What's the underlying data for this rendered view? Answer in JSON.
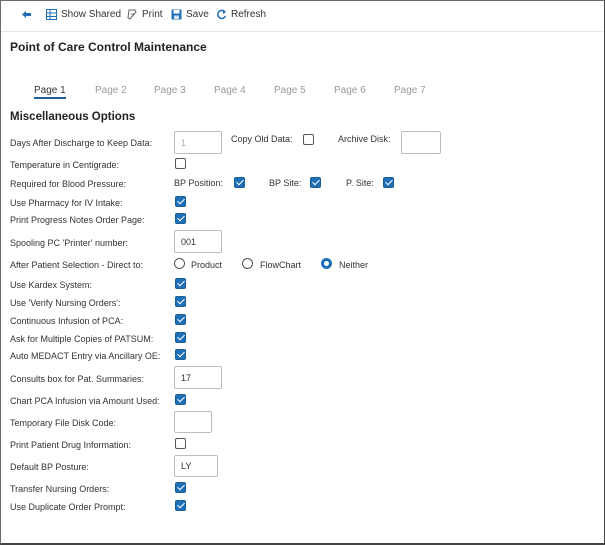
{
  "toolbar": {
    "show_shared": "Show Shared",
    "print": "Print",
    "save": "Save",
    "refresh": "Refresh"
  },
  "title": "Point of Care Control Maintenance",
  "tabs": [
    "Page 1",
    "Page 2",
    "Page 3",
    "Page 4",
    "Page 5",
    "Page 6",
    "Page 7"
  ],
  "active_tab": "Page 1",
  "section": "Miscellaneous Options",
  "fields": {
    "days_after_discharge": {
      "label": "Days After Discharge to Keep Data:",
      "value": "1"
    },
    "copy_old_data": {
      "label": "Copy Old Data:",
      "checked": false
    },
    "archive_disk": {
      "label": "Archive Disk:",
      "value": ""
    },
    "temperature": {
      "label": "Temperature in Centigrade:",
      "checked": false
    },
    "required_bp": {
      "label": "Required for Blood Pressure:"
    },
    "bp_position": {
      "label": "BP Position:",
      "checked": true
    },
    "bp_site": {
      "label": "BP Site:",
      "checked": true
    },
    "p_site": {
      "label": "P. Site:",
      "checked": true
    },
    "use_pharmacy": {
      "label": "Use Pharmacy for IV Intake:",
      "checked": true
    },
    "print_progress": {
      "label": "Print Progress Notes Order Page:",
      "checked": true
    },
    "spooling_pc": {
      "label": "Spooling PC 'Printer' number:",
      "value": "001"
    },
    "after_patient": {
      "label": "After Patient Selection - Direct to:",
      "options": [
        "Product",
        "FlowChart",
        "Neither"
      ],
      "selected": "Neither"
    },
    "use_kardex": {
      "label": "Use Kardex System:",
      "checked": true
    },
    "verify_nursing": {
      "label": "Use 'Verify Nursing Orders':",
      "checked": true
    },
    "continuous_pca": {
      "label": "Continuous Infusion of PCA:",
      "checked": true
    },
    "ask_multiple": {
      "label": "Ask for Multiple Copies of PATSUM:",
      "checked": true
    },
    "auto_medact": {
      "label": "Auto MEDACT Entry via Ancillary OE:",
      "checked": true
    },
    "consults_box": {
      "label": "Consults box for Pat. Summaries:",
      "value": "17"
    },
    "chart_pca": {
      "label": "Chart PCA Infusion via Amount Used:",
      "checked": true
    },
    "temp_file_disk": {
      "label": "Temporary File Disk Code:",
      "value": ""
    },
    "print_patient_drug": {
      "label": "Print Patient Drug Information:",
      "checked": false
    },
    "default_bp": {
      "label": "Default BP Posture:",
      "value": "LY"
    },
    "transfer_nursing": {
      "label": "Transfer Nursing Orders:",
      "checked": true
    },
    "duplicate_order": {
      "label": "Use Duplicate Order Prompt:",
      "checked": true
    }
  }
}
